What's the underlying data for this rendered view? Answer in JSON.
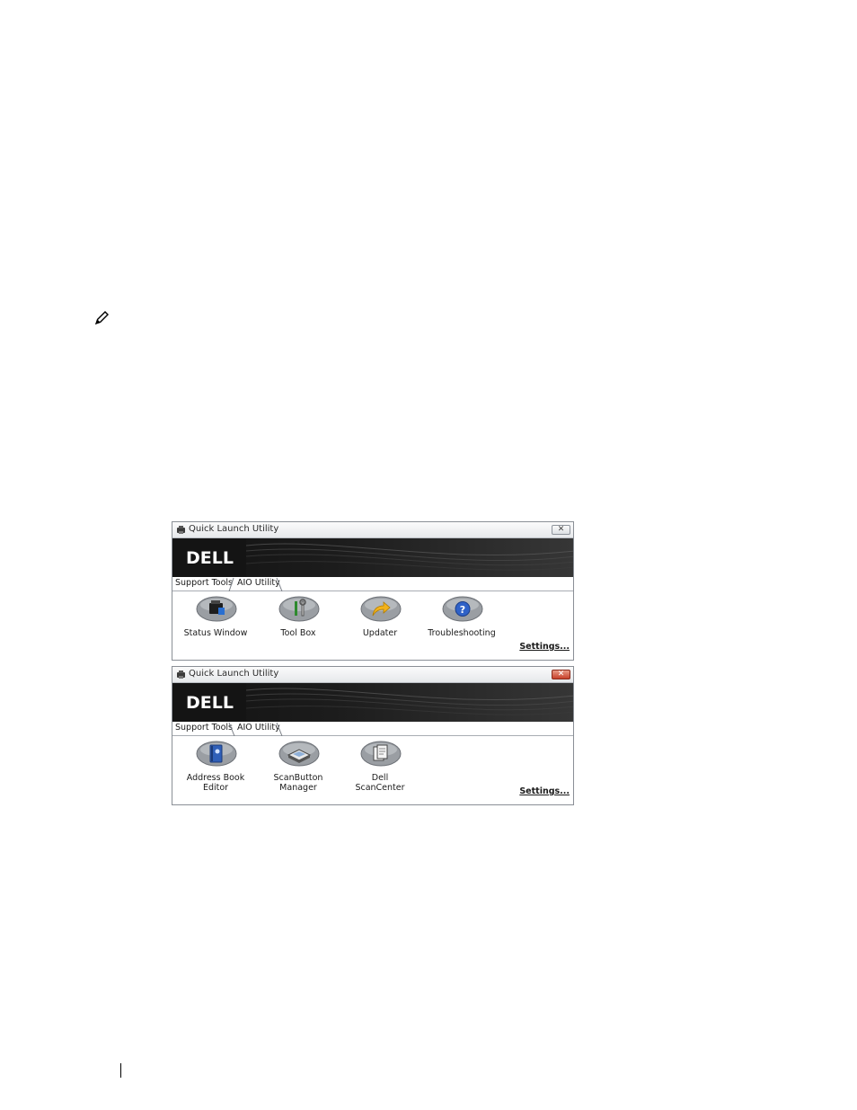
{
  "windows": [
    {
      "title": "Quick Launch Utility",
      "logo": "DELL",
      "close_state": "inactive",
      "tabs": [
        {
          "label": "Support Tools",
          "active": true
        },
        {
          "label": "AIO Utility",
          "active": false
        }
      ],
      "items": [
        {
          "label": "Status Window",
          "icon": "printer-status-icon"
        },
        {
          "label": "Tool Box",
          "icon": "toolbox-icon"
        },
        {
          "label": "Updater",
          "icon": "update-arrow-icon"
        },
        {
          "label": "Troubleshooting",
          "icon": "help-icon"
        }
      ],
      "settings_label": "Settings..."
    },
    {
      "title": "Quick Launch Utility",
      "logo": "DELL",
      "close_state": "active",
      "tabs": [
        {
          "label": "Support Tools",
          "active": false
        },
        {
          "label": "AIO Utility",
          "active": true
        }
      ],
      "items": [
        {
          "label": "Address Book\nEditor",
          "icon": "address-book-icon"
        },
        {
          "label": "ScanButton\nManager",
          "icon": "scanner-icon"
        },
        {
          "label": "Dell\nScanCenter",
          "icon": "scan-center-icon"
        }
      ],
      "settings_label": "Settings..."
    }
  ],
  "colors": {
    "banner": "#1a1a1a",
    "window_border": "#8a8f96",
    "close_active": "#c7402a",
    "button_gray": "#9a9ea3"
  }
}
